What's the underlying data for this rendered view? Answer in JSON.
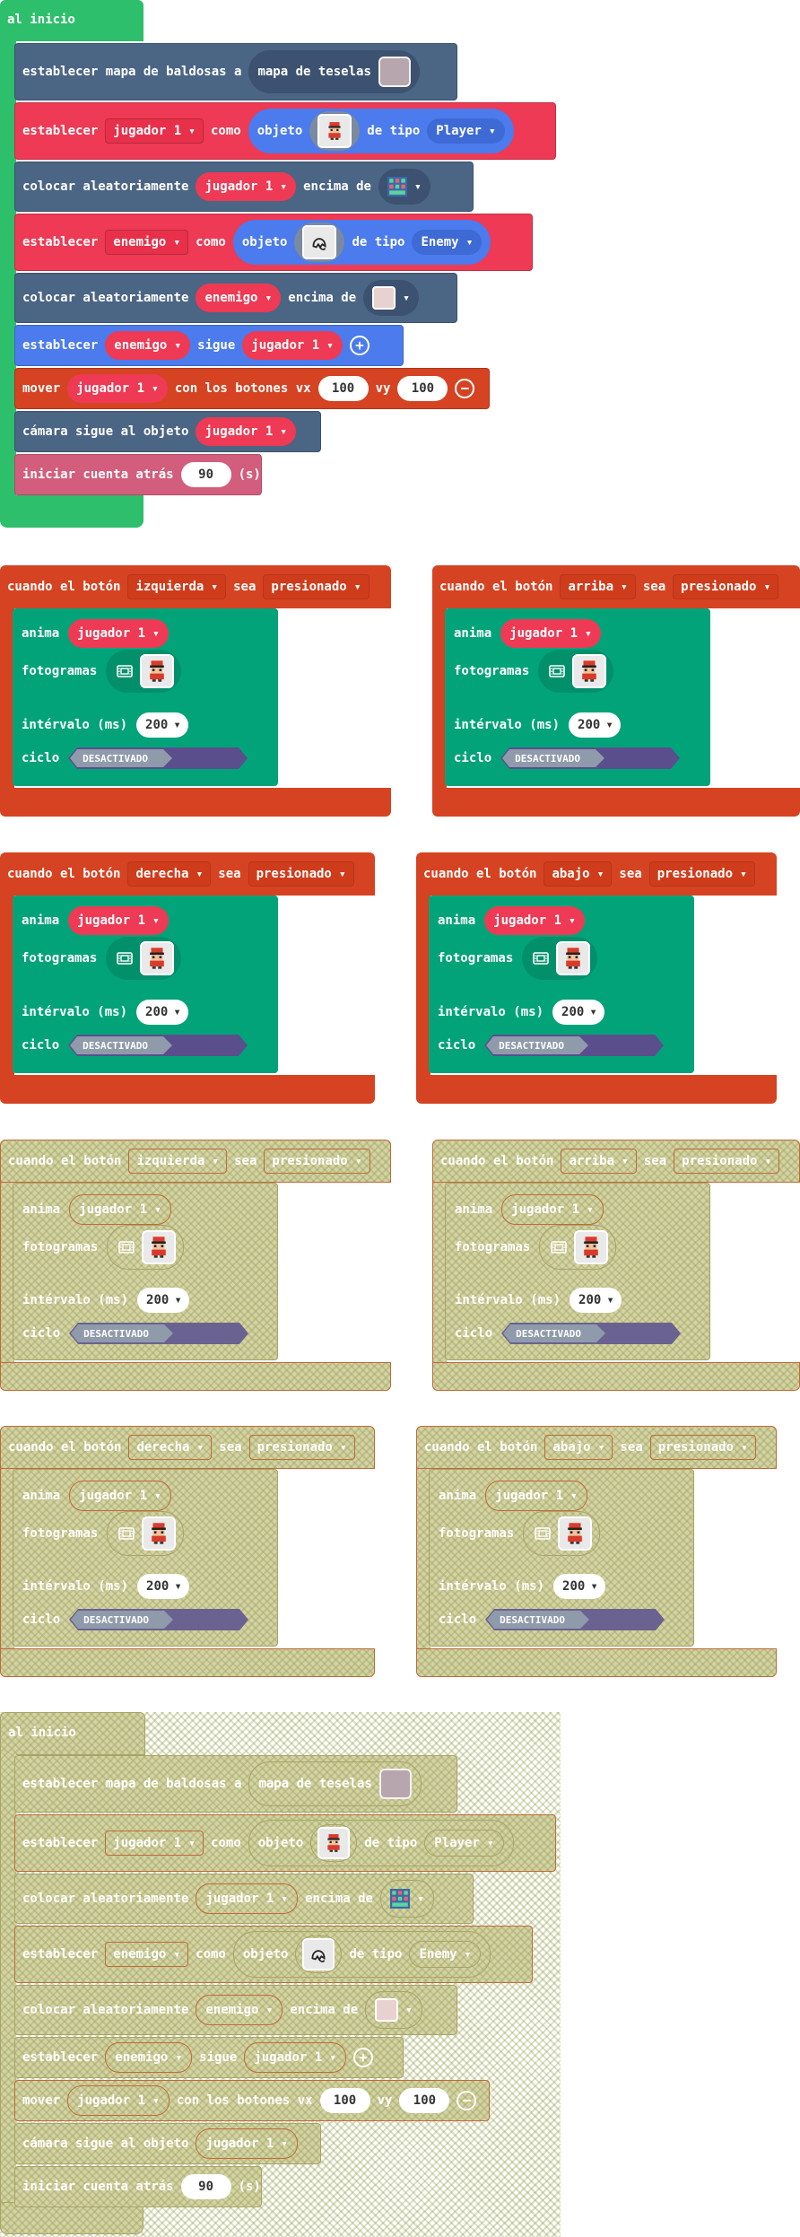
{
  "labels": {
    "on_start": "al inicio",
    "set_tilemap": "establecer mapa de baldosas a",
    "tilemap": "mapa de teselas",
    "set": "establecer",
    "as": "como",
    "sprite": "objeto",
    "of_kind": "de tipo",
    "place_random": "colocar aleatoriamente",
    "on_top_of": "encima de",
    "follows": "sigue",
    "move": "mover",
    "with_buttons_vx": "con los botones vx",
    "vy": "vy",
    "camera_follow": "cámara sigue al objeto",
    "countdown": "iniciar cuenta atrás",
    "seconds_unit": "(s)",
    "when_button": "cuando el botón",
    "is": "sea",
    "pressed": "presionado",
    "animate": "anima",
    "frames": "fotogramas",
    "interval": "intérvalo (ms)",
    "loop": "ciclo",
    "off": "DESACTIVADO"
  },
  "vars": {
    "player": "jugador 1",
    "enemy": "enemigo"
  },
  "kinds": {
    "player": "Player",
    "enemy": "Enemy"
  },
  "values": {
    "vx": "100",
    "vy": "100",
    "countdown": "90",
    "interval": "200"
  },
  "buttons": {
    "left": "izquierda",
    "up": "arriba",
    "right": "derecha",
    "down": "abajo"
  },
  "colors": {
    "loops_green": "#2dbf6b",
    "scene_slate": "#4b6584",
    "sprites_red": "#ee3a54",
    "sprites_blue": "#4b7bec",
    "controller_orange": "#d54322",
    "animation_teal": "#03a37a",
    "info_pink": "#d35d7d",
    "disabled_bg": "#d4d2a6",
    "disabled_border": "#a8a468",
    "disabled_outline": "#c06a3a"
  },
  "icons": [
    "film-icon",
    "player-sprite-icon",
    "enemy-sprite-icon",
    "tilemap-icon",
    "tile-icon",
    "plus-icon",
    "minus-icon"
  ]
}
